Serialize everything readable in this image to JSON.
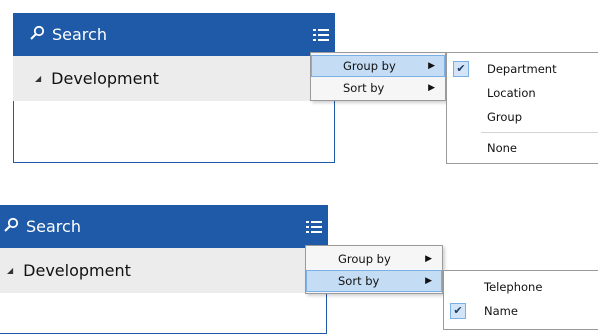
{
  "screenshot_top": {
    "search_label": "Search",
    "group_title": "Development",
    "menu": [
      {
        "label": "Group by",
        "highlighted": true
      },
      {
        "label": "Sort by",
        "highlighted": false
      }
    ],
    "submenu": {
      "items": [
        "Department",
        "Location",
        "Group",
        "None"
      ],
      "checked": "Department"
    }
  },
  "screenshot_bottom": {
    "search_label": "Search",
    "group_title": "Development",
    "menu": [
      {
        "label": "Group by",
        "highlighted": false
      },
      {
        "label": "Sort by",
        "highlighted": true
      }
    ],
    "submenu": {
      "items": [
        "Telephone",
        "Name"
      ],
      "checked": "Name"
    }
  },
  "colors": {
    "header": "#1f5aa8",
    "highlight": "#c4dcf4"
  },
  "icons": {
    "search": "magnifier-icon",
    "menu": "hamburger-list-icon",
    "check": "checkmark-icon",
    "submenu_arrow": "triangle-right-icon",
    "collapse": "triangle-collapse-icon"
  }
}
